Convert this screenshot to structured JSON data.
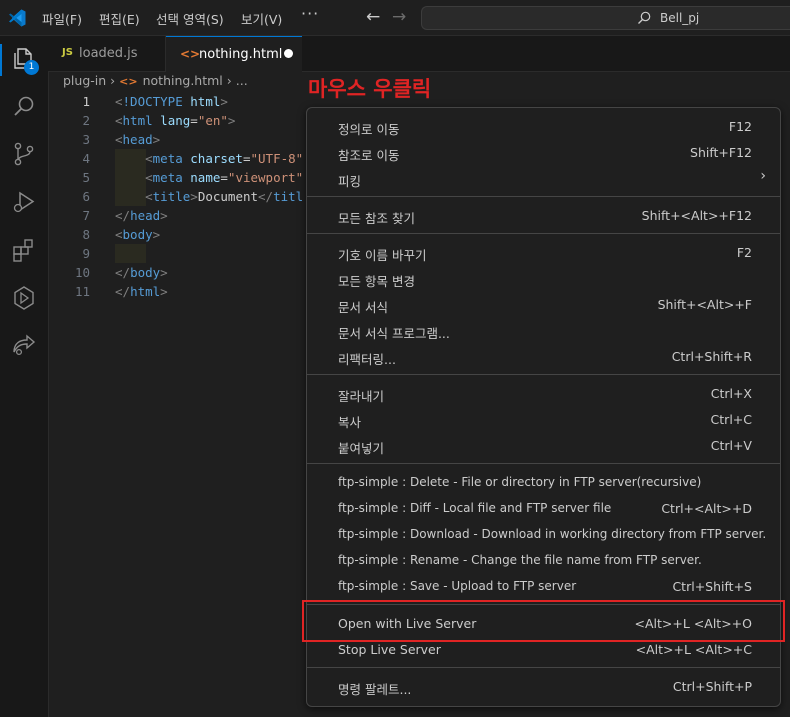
{
  "titlebar": {
    "menus": [
      "파일(F)",
      "편집(E)",
      "선택 영역(S)",
      "보기(V)"
    ],
    "more": "···",
    "search_text": "Bell_pj"
  },
  "activity": {
    "badge": "1"
  },
  "tabs": [
    {
      "icon": "JS",
      "label": "loaded.js"
    },
    {
      "icon": "<>",
      "label": "nothing.html"
    }
  ],
  "breadcrumb": {
    "folder": "plug-in",
    "file": "nothing.html",
    "more": "..."
  },
  "annotation": "마우스 우클릭",
  "editor": {
    "line_numbers": [
      "1",
      "2",
      "3",
      "4",
      "5",
      "6",
      "7",
      "8",
      "9",
      "10",
      "11"
    ]
  },
  "context_menu": {
    "items": [
      {
        "label": "정의로 이동",
        "key": "F12"
      },
      {
        "label": "참조로 이동",
        "key": "Shift+F12"
      },
      {
        "label": "피킹",
        "key": ""
      },
      {
        "label": "모든 참조 찾기",
        "key": "Shift+<Alt>+F12"
      },
      {
        "label": "기호 이름 바꾸기",
        "key": "F2"
      },
      {
        "label": "모든 항목 변경",
        "key": ""
      },
      {
        "label": "문서 서식",
        "key": "Shift+<Alt>+F"
      },
      {
        "label": "문서 서식 프로그램...",
        "key": ""
      },
      {
        "label": "리팩터링...",
        "key": "Ctrl+Shift+R"
      },
      {
        "label": "잘라내기",
        "key": "Ctrl+X"
      },
      {
        "label": "복사",
        "key": "Ctrl+C"
      },
      {
        "label": "붙여넣기",
        "key": "Ctrl+V"
      },
      {
        "label": "ftp-simple : Delete - File or directory in FTP server(recursive)",
        "key": ""
      },
      {
        "label": "ftp-simple : Diff - Local file and FTP server file",
        "key": "Ctrl+<Alt>+D"
      },
      {
        "label": "ftp-simple : Download - Download in working directory from FTP server.",
        "key": ""
      },
      {
        "label": "ftp-simple : Rename - Change the file name from FTP server.",
        "key": ""
      },
      {
        "label": "ftp-simple : Save - Upload to FTP server",
        "key": "Ctrl+Shift+S"
      },
      {
        "label": "Open with Live Server",
        "key": "<Alt>+L <Alt>+O"
      },
      {
        "label": "Stop Live Server",
        "key": "<Alt>+L <Alt>+C"
      },
      {
        "label": "명령 팔레트...",
        "key": "Ctrl+Shift+P"
      }
    ]
  },
  "colors": {
    "accent": "#0078d4",
    "highlight_red": "#e02424"
  }
}
